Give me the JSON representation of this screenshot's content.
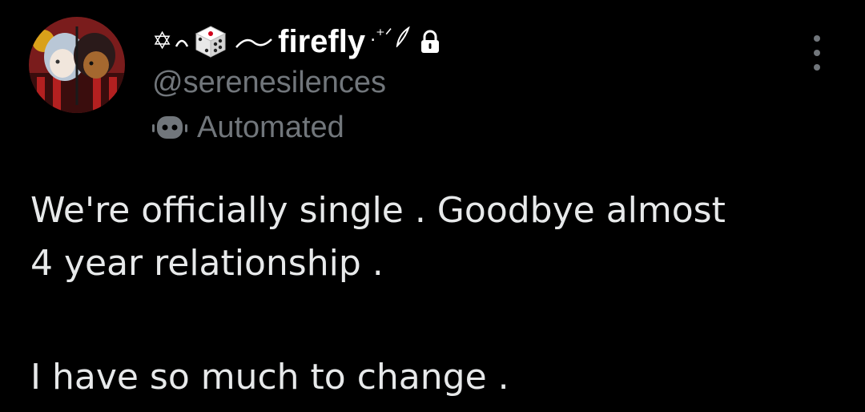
{
  "user": {
    "deco_prefix": "✡",
    "display_name": "firefly",
    "deco_suffix": ".⁺ᐟ",
    "handle": "@serenesilences",
    "label": "Automated"
  },
  "tweet": {
    "lines": [
      "We're officially single . Goodbye almost",
      "4 year relationship ."
    ],
    "second_paragraph": "I have so much to change ."
  },
  "icons": {
    "avatar": "avatar-image",
    "dice": "dice-icon",
    "lock": "lock-icon",
    "bot": "bot-icon",
    "more": "more-icon"
  },
  "colors": {
    "background": "#000000",
    "primary_text": "#e7e9ea",
    "secondary_text": "#71767b"
  }
}
